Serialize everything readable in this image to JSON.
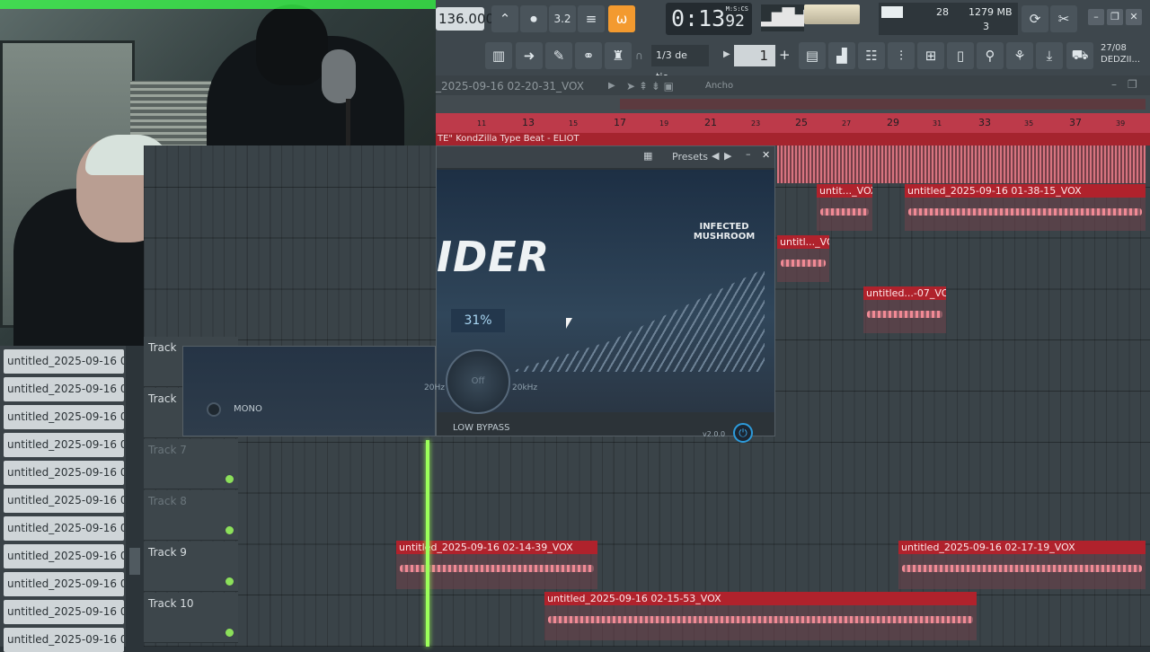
{
  "toolbar": {
    "tempo": "136.000",
    "pattern_icon_label": "3.2",
    "time": "0:13",
    "time_sub": "92",
    "time_units": "M:S:CS",
    "cpu_value": "28",
    "ram_value": "1279 MB",
    "voices": "3",
    "snap": "1/3 de tie...",
    "pattern_number": "1",
    "news_date": "27/08",
    "news_text": "DEDZII..."
  },
  "playlist": {
    "title": "_2025-09-16 02-20-31_VOX",
    "width_label": "Ancho",
    "ruler": [
      "11",
      "13",
      "15",
      "17",
      "19",
      "21",
      "23",
      "25",
      "27",
      "29",
      "31",
      "33",
      "35",
      "37",
      "39"
    ],
    "beat_strip": "TE\" KondZilla Type Beat - ELIOT",
    "tracks": [
      {
        "name": "Track",
        "dim": false
      },
      {
        "name": "Track",
        "dim": false
      },
      {
        "name": "Track 7",
        "dim": true
      },
      {
        "name": "Track 8",
        "dim": true
      },
      {
        "name": "Track 9",
        "dim": false
      },
      {
        "name": "Track 10",
        "dim": false
      }
    ],
    "clips": [
      {
        "label": "untit..._VOX"
      },
      {
        "label": "untitled_2025-09-16 01-38-15_VOX"
      },
      {
        "label": "untitl..._VOX"
      },
      {
        "label": "untitled...-07_VOX"
      },
      {
        "label": "untitled_2025-09-16 02-14-39_VOX"
      },
      {
        "label": "untitled_2025-09-16 02-17-19_VOX"
      },
      {
        "label": "untitled_2025-09-16 02-15-53_VOX"
      }
    ]
  },
  "browser": {
    "items": [
      "untitled_2025-09-16 02...",
      "untitled_2025-09-16 02...",
      "untitled_2025-09-16 02...",
      "untitled_2025-09-16 02...",
      "untitled_2025-09-16 02...",
      "untitled_2025-09-16 02...",
      "untitled_2025-09-16 02...",
      "untitled_2025-09-16 02...",
      "untitled_2025-09-16 02...",
      "untitled_2025-09-16 02...",
      "untitled_2025-09-16 02..."
    ]
  },
  "plugin": {
    "presets": "Presets",
    "title": "IDER",
    "brand": "INFECTED MUSHROOM",
    "width_pct": "31%",
    "knob_state": "Off",
    "freq_low": "20Hz",
    "freq_high": "20kHz",
    "bypass_label": "LOW BYPASS",
    "mono_label": "MONO",
    "version": "v2.0.0"
  },
  "colors": {
    "accent": "#f39a2f",
    "ruler": "#bd3a4a",
    "clip_header": "#b0222c",
    "playhead": "#9cff5a",
    "plugin_blue": "#2d9bdb"
  }
}
